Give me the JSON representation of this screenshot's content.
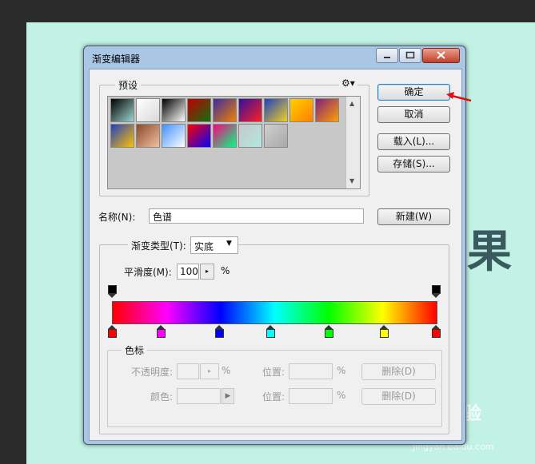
{
  "dialog": {
    "title": "渐变编辑器",
    "ok_label": "确定",
    "cancel_label": "取消",
    "load_label": "载入(L)...",
    "save_label": "存储(S)...",
    "new_label": "新建(W)"
  },
  "presets": {
    "label": "预设",
    "swatches": [
      [
        "#000000",
        "#9dd5d0"
      ],
      [
        "#ffffff",
        "#d9d9d9"
      ],
      [
        "#000000",
        "#ffffff"
      ],
      [
        "#c00000",
        "#107010"
      ],
      [
        "#3b2aa0",
        "#f08000"
      ],
      [
        "#3010a0",
        "#ff2020"
      ],
      [
        "#2040c0",
        "#f0d020"
      ],
      [
        "#ffd000",
        "#ff8000"
      ],
      [
        "#802080",
        "#ffa000"
      ],
      [
        "#2040c0",
        "#ffc000"
      ],
      [
        "#8a4a2a",
        "#f0c0a0"
      ],
      [
        "#4090ff",
        "#ffffff"
      ],
      [
        "#ff0000",
        "#0000ff"
      ],
      [
        "#ff0080",
        "#00ff80"
      ],
      [
        "#c8c8c8",
        "#b0e8e0"
      ],
      [
        "#cfcfcf",
        "#a8a8a8"
      ]
    ]
  },
  "name": {
    "label": "名称(N):",
    "value": "色谱"
  },
  "gradient": {
    "type_label": "渐变类型(T):",
    "type_value": "实底",
    "smooth_label": "平滑度(M):",
    "smooth_value": "100",
    "smooth_unit": "%",
    "colors": [
      "#ff0000",
      "#ff00ff",
      "#0000ff",
      "#00ffff",
      "#00ff00",
      "#ffff00",
      "#ff0000"
    ],
    "color_stops": [
      {
        "color": "#ff0000",
        "pos": 0
      },
      {
        "color": "#ff00ff",
        "pos": 0.15
      },
      {
        "color": "#0000ff",
        "pos": 0.33
      },
      {
        "color": "#00ffff",
        "pos": 0.49
      },
      {
        "color": "#00ff00",
        "pos": 0.67
      },
      {
        "color": "#ffff00",
        "pos": 0.84
      },
      {
        "color": "#ff0000",
        "pos": 1
      }
    ],
    "opacity_stops": [
      {
        "color": "#000000",
        "pos": 0
      },
      {
        "color": "#000000",
        "pos": 1
      }
    ]
  },
  "stops": {
    "label": "色标",
    "opacity_label": "不透明度:",
    "opacity_unit": "%",
    "location_label": "位置:",
    "location_unit": "%",
    "delete_label": "删除(D)",
    "color_label": "颜色:",
    "location2_label": "位置:",
    "location2_unit": "%",
    "delete2_label": "删除(D)"
  },
  "background": {
    "char": "果",
    "watermark": "Bai 经验",
    "watermark_url": "jingyan.baidu.com"
  }
}
